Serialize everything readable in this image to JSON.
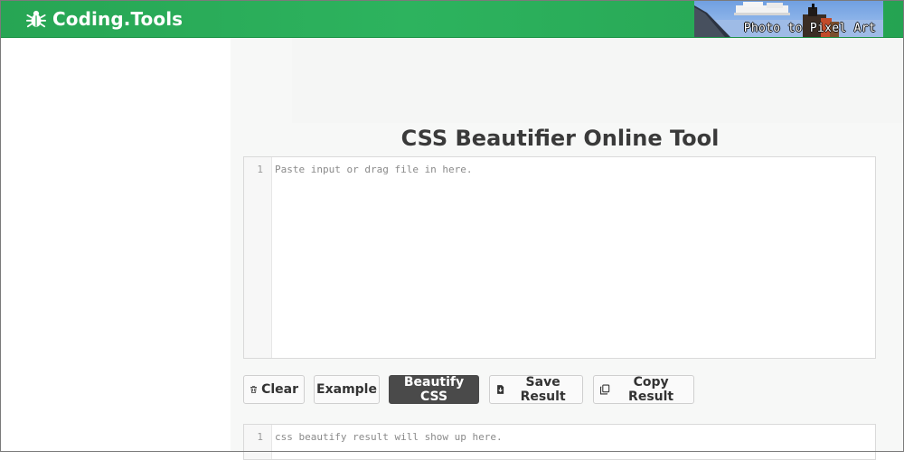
{
  "header": {
    "logo_text": "Coding.Tools",
    "banner_text": "Photo to Pixel Art",
    "bg_color": "#2aac58"
  },
  "main": {
    "title": "CSS Beautifier Online Tool",
    "input_editor": {
      "line_number": "1",
      "placeholder": "Paste input or drag file in here."
    },
    "output_editor": {
      "line_number": "1",
      "placeholder": "css beautify result will show up here."
    }
  },
  "buttons": {
    "clear": {
      "label": "Clear",
      "icon": "trash-icon"
    },
    "example": {
      "label": "Example"
    },
    "beautify": {
      "label": "Beautify CSS",
      "color": "#4a4a4a"
    },
    "save": {
      "label": "Save Result",
      "icon": "file-download-icon"
    },
    "copy": {
      "label": "Copy Result",
      "icon": "copy-icon"
    }
  }
}
